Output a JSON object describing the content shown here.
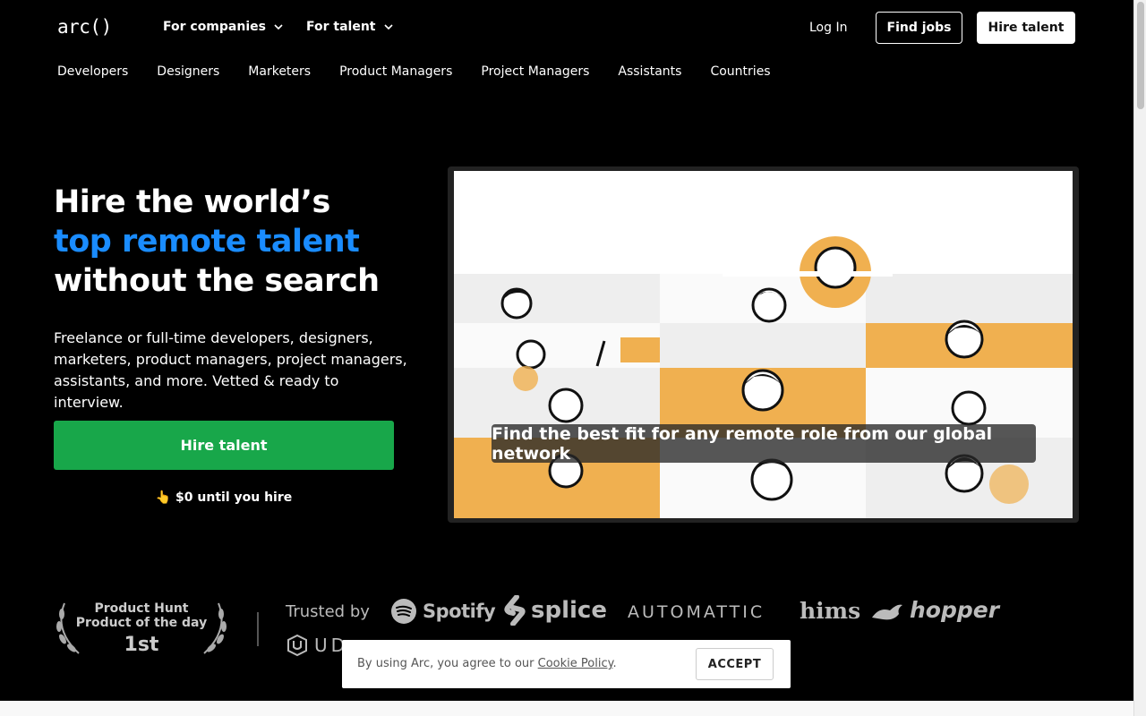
{
  "header": {
    "logo": "arc()",
    "nav": [
      {
        "label": "For companies"
      },
      {
        "label": "For talent"
      }
    ],
    "login": "Log In",
    "find_jobs": "Find jobs",
    "hire_talent": "Hire talent"
  },
  "subnav": [
    "Developers",
    "Designers",
    "Marketers",
    "Product Managers",
    "Project Managers",
    "Assistants",
    "Countries"
  ],
  "hero": {
    "title_line1": "Hire the world’s",
    "title_line2": "top remote talent",
    "title_line3": "without the search",
    "subtitle": "Freelance or full-time developers, designers, marketers, product managers, project managers, assistants, and more. Vetted & ready to interview.",
    "cta": "Hire talent",
    "cta_note": "👆 $0 until you hire"
  },
  "video": {
    "caption": "Find the best fit for any remote role from our global network"
  },
  "trust": {
    "award_line1": "Product Hunt",
    "award_line2": "Product of the day",
    "award_rank": "1st",
    "trusted_by": "Trusted by",
    "brands": [
      "Spotify",
      "splice",
      "AUTOMATTIC",
      "hims",
      "hopper",
      "UD"
    ]
  },
  "cookie": {
    "text": "By using Arc, you agree to our",
    "link": "Cookie Policy",
    "period": ".",
    "button": "ACCEPT"
  },
  "colors": {
    "accent_blue": "#1a8cff",
    "cta_green": "#18a74a",
    "illustration_orange": "#f0b050"
  }
}
